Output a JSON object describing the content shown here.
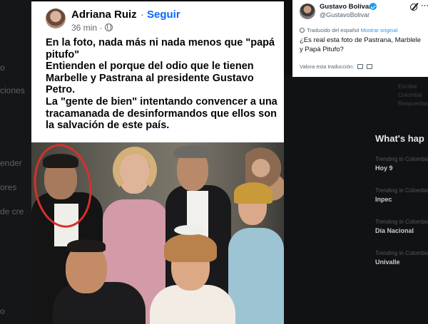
{
  "background": {
    "left_items": [
      "o",
      "ciones",
      "ender",
      "ores",
      "de cre",
      "o"
    ],
    "right_header": "What's hap",
    "right_items": [
      {
        "sub": "Trending in Colombia",
        "label": "Hoy 9"
      },
      {
        "sub": "Trending in Colombia",
        "label": "Inpec"
      },
      {
        "sub": "Trending in Colombia",
        "label": "Día Nacional"
      },
      {
        "sub": "Trending in Colombia",
        "label": "Univalle"
      }
    ],
    "right_faint": [
      "Escribe",
      "Colombia",
      "Respuestas"
    ]
  },
  "facebook_post": {
    "author": "Adriana Ruiz",
    "separator": "·",
    "follow_label": "Seguir",
    "time": "36 min ·",
    "paragraphs": [
      "En la foto, nada más ni nada menos que \"papá pitufo\"",
      "Entienden el porque del odio que le tienen Marbelle y Pastrana al presidente Gustavo Petro.",
      "La \"gente de bien\" intentando convencer a una tracamanada de desinformandos que ellos son la salvación de este país."
    ],
    "icons": {
      "privacy": "globe-icon"
    }
  },
  "tweet": {
    "name": "Gustavo Bolívar",
    "handle": "@GustavoBolivar",
    "translated_label": "Traducido del español",
    "show_original": "Mostrar original",
    "text": "¿Es real esta foto de Pastrana, Marblele y Papá Pitufo?",
    "rate_label": "Valora esta traducción:",
    "icons": {
      "verified": "verified-icon",
      "grok": "grok-icon",
      "more": "more-icon",
      "like": "thumbs-up-icon",
      "dislike": "thumbs-down-icon"
    },
    "colors": {
      "link": "#1d9bf0",
      "verified": "#1d9bf0"
    }
  },
  "colors": {
    "follow": "#0866ff",
    "circle": "#d6302a"
  }
}
